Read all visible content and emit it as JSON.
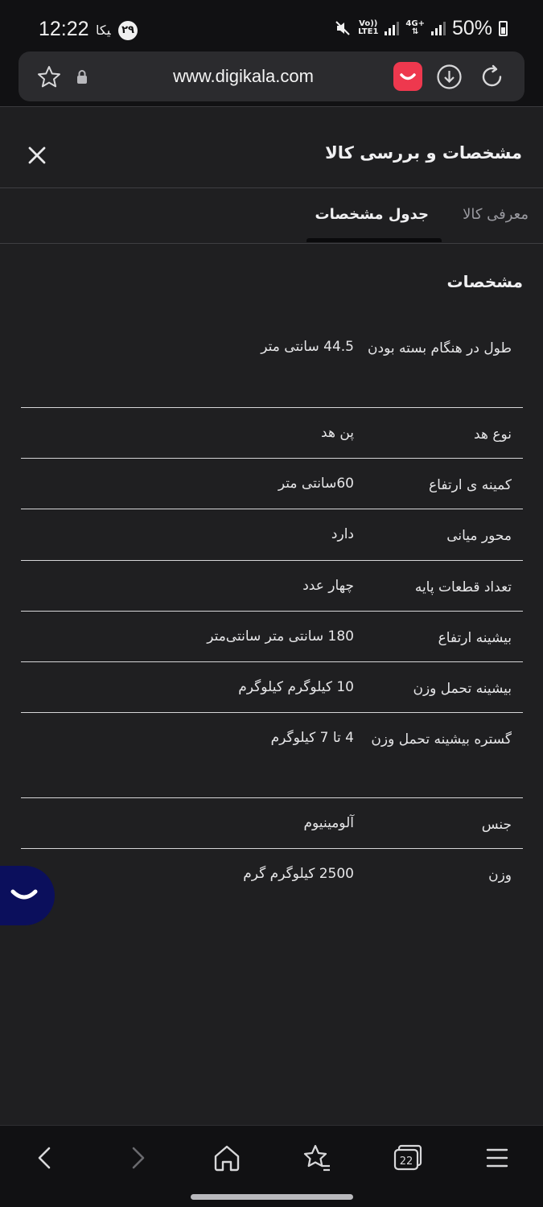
{
  "status_bar": {
    "time": "12:22",
    "app_badge_1": "ﯿﮑﺎ",
    "app_badge_2": "۲۹",
    "volte": "Vo))",
    "lte": "LTE1",
    "net4g": "4G+",
    "battery": "50%"
  },
  "browser": {
    "url": "www.digikala.com"
  },
  "header": {
    "title": "مشخصات و بررسی کالا"
  },
  "tabs": [
    {
      "label": "معرفی کالا",
      "active": false
    },
    {
      "label": "جدول مشخصات",
      "active": true
    }
  ],
  "section": {
    "title": "مشخصات"
  },
  "specs": [
    {
      "key": "طول در هنگام بسته بودن",
      "value": "44.5 سانتی متر"
    },
    {
      "key": "نوع هد",
      "value": "پن هد"
    },
    {
      "key": "کمینه ی ارتفاع",
      "value": "60سانتی متر"
    },
    {
      "key": "محور میانی",
      "value": "دارد"
    },
    {
      "key": "تعداد قطعات پایه",
      "value": "چهار عدد"
    },
    {
      "key": "بیشینه ارتفاع",
      "value": "180 سانتی متر سانتی‌متر"
    },
    {
      "key": "بیشینه تحمل وزن",
      "value": "10 کیلوگرم کیلوگرم"
    },
    {
      "key": "گستره بیشینه تحمل وزن",
      "value": "4 تا 7 کیلوگرم"
    },
    {
      "key": "جنس",
      "value": "آلومینیوم"
    },
    {
      "key": "وزن",
      "value": "2500 کیلوگرم گرم"
    }
  ],
  "bottom_nav": {
    "tab_count": "22"
  },
  "colors": {
    "background": "#1f1f21",
    "brand_red": "#ee384e",
    "chat_blue": "#0b0f5c"
  }
}
